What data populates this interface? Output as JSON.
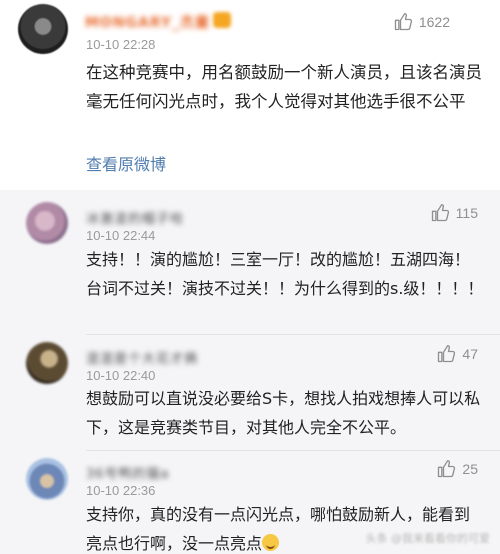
{
  "main_comment": {
    "username": "MONGARY_杰童",
    "timestamp": "10-10 22:28",
    "likes": "1622",
    "text": "在这种竞赛中，用名额鼓励一个新人演员，且该名演员毫无任何闪光点时，我个人觉得对其他选手很不公平",
    "view_original": "查看原微博"
  },
  "replies": [
    {
      "username": "冰激凌的帽子哈",
      "timestamp": "10-10 22:44",
      "likes": "115",
      "text": "支持！！演的尴尬！三室一厅！改的尴尬！五湖四海！台词不过关！演技不过关！！为什么得到的s.级！！！！"
    },
    {
      "username": "混混是个大花才俩",
      "timestamp": "10-10 22:40",
      "likes": "47",
      "text": "想鼓励可以直说没必要给S卡，想找人拍戏想捧人可以私下，这是竞赛类节目，对其他人完全不公平。"
    },
    {
      "username": "36号鸭的猫a",
      "timestamp": "10-10 22:36",
      "likes": "25",
      "text": "支持你，真的没有一点闪光点，哪怕鼓励新人，能看到亮点也行啊，没一点亮点"
    }
  ],
  "watermark": "头条 @我来看看你的可爱"
}
